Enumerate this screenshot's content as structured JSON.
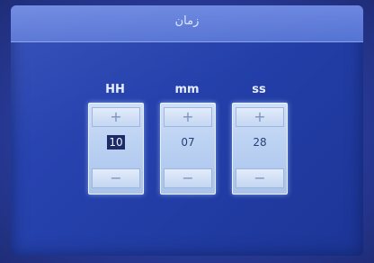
{
  "window": {
    "title": "زمان"
  },
  "columns": [
    {
      "label": "HH",
      "value": "10",
      "plus_icon": "+",
      "minus_icon": "−"
    },
    {
      "label": "mm",
      "value": "07",
      "plus_icon": "+",
      "minus_icon": "−"
    },
    {
      "label": "ss",
      "value": "28",
      "plus_icon": "+",
      "minus_icon": "−"
    }
  ],
  "colors": {
    "background": "#2440aa",
    "title_bar": "#5f7ddb",
    "spinner": "#c2d6f2",
    "selected_value_bg": "#1d2c68"
  },
  "selected_column": "HH"
}
